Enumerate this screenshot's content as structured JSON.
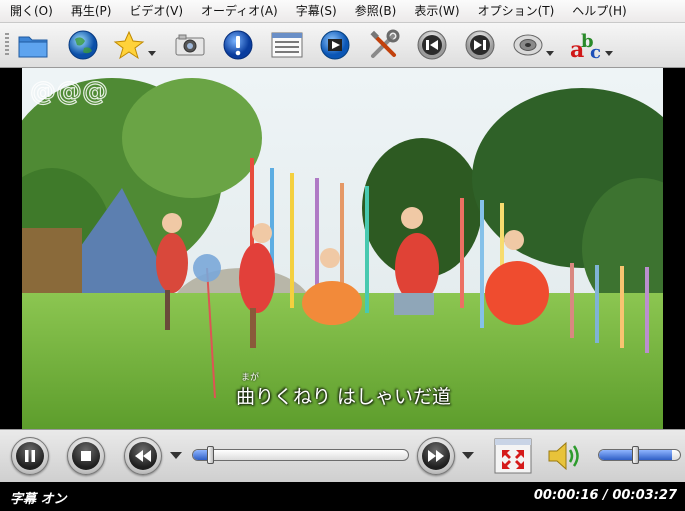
{
  "menu": [
    "開く(O)",
    "再生(P)",
    "ビデオ(V)",
    "オーディオ(A)",
    "字幕(S)",
    "参照(B)",
    "表示(W)",
    "オプション(T)",
    "ヘルプ(H)"
  ],
  "toolbar": [
    "folder-icon",
    "globe-icon",
    "star-icon",
    "camera-icon",
    "info-icon",
    "playlist-icon",
    "dvd-icon",
    "tools-icon",
    "previous-icon",
    "next-icon",
    "audio-track-icon",
    "subtitle-icon"
  ],
  "video": {
    "subtitle_text": "曲りくねり はしゃいだ道",
    "subtitle_ruby": "まが"
  },
  "controls": {
    "seek_fraction": 0.084,
    "volume_fraction": 0.9
  },
  "status": {
    "left": "字幕 オン",
    "time": "00:00:16 / 00:03:27"
  }
}
